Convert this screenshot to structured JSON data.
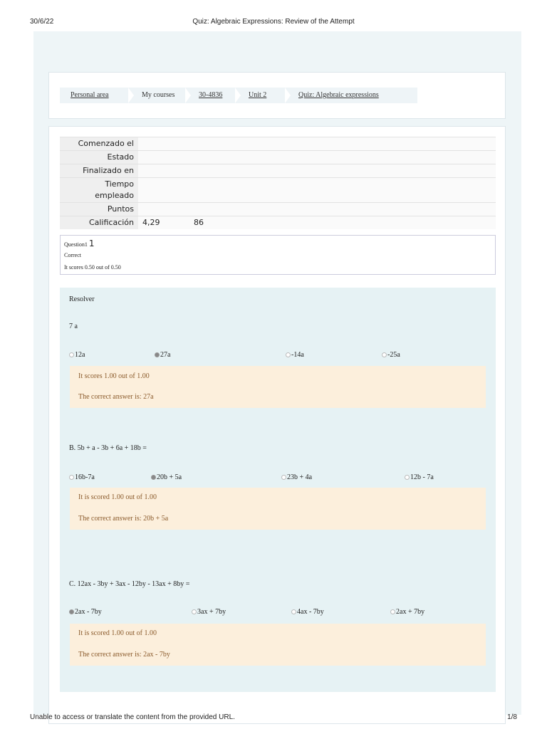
{
  "header": {
    "date": "30/6/22",
    "title": "Quiz: Algebraic Expressions: Review of the Attempt"
  },
  "footer": {
    "message": "Unable to access or translate the content from the provided URL.",
    "page": "1/8"
  },
  "breadcrumb": [
    {
      "label": "Personal area",
      "link": true
    },
    {
      "label": "My courses",
      "link": false
    },
    {
      "label": "30-4836",
      "link": true
    },
    {
      "label": "Unit 2",
      "link": true
    },
    {
      "label": "Quiz: Algebraic expressions",
      "link": true
    }
  ],
  "summary": [
    {
      "k": "Comenzado el",
      "v": "",
      "v2": ""
    },
    {
      "k": "Estado",
      "v": "",
      "v2": ""
    },
    {
      "k": "Finalizado en",
      "v": "",
      "v2": ""
    },
    {
      "k": "Tiempo empleado",
      "v": "",
      "v2": ""
    },
    {
      "k": "Puntos",
      "v": "",
      "v2": ""
    },
    {
      "k": "Calificación",
      "v": "4,29",
      "v2": "86"
    }
  ],
  "question": {
    "label": "Question1",
    "number": "1",
    "status": "Correct",
    "score": "It scores 0.50 out of 0.50"
  },
  "body": {
    "instruction": "Resolver",
    "parts": [
      {
        "prompt": "7 a",
        "options": [
          "12a",
          "27a",
          "-14a",
          "-25a"
        ],
        "selected": 1,
        "score": "It scores 1.00 out of 1.00",
        "answer": "The correct answer is: 27a"
      },
      {
        "prompt": "B. 5b + a - 3b + 6a + 18b =",
        "options": [
          "16b-7a",
          "20b + 5a",
          "23b + 4a",
          "12b - 7a"
        ],
        "selected": 1,
        "score": "It is scored 1.00 out of 1.00",
        "answer": "The correct answer is: 20b + 5a"
      },
      {
        "prompt": "C. 12ax - 3by + 3ax - 12by - 13ax + 8by =",
        "options": [
          "2ax - 7by",
          "3ax + 7by",
          "4ax - 7by",
          "2ax + 7by"
        ],
        "selected": 0,
        "score": "It is scored 1.00 out of 1.00",
        "answer": "The correct answer is: 2ax - 7by"
      }
    ]
  }
}
